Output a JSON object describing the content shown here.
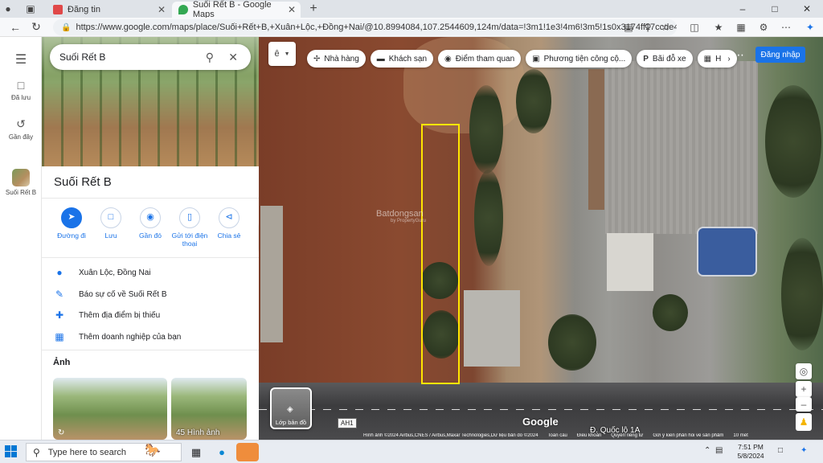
{
  "browser": {
    "tabs": [
      {
        "label": "Đăng tin",
        "active": false
      },
      {
        "label": "Suối Rết B - Google Maps",
        "active": true
      }
    ],
    "new_tab_label": "+",
    "url": "https://www.google.com/maps/place/Suối+Rết+B,+Xuân+Lộc,+Đồng+Nai/@10.8994084,107.2544609,124m/data=!3m1!1e3!4m6!3m5!1s0x3174ff17ccde4bf3:..."
  },
  "rail": {
    "saved_label": "Đã lưu",
    "recent_label": "Gần đây",
    "place_label": "Suối Rết B"
  },
  "panel": {
    "search_value": "Suối Rết B",
    "title": "Suối Rết B",
    "actions": [
      {
        "label": "Đường đi"
      },
      {
        "label": "Lưu"
      },
      {
        "label": "Gần đó"
      },
      {
        "label": "Gửi tới điện thoại"
      },
      {
        "label": "Chia sẻ"
      }
    ],
    "info": [
      {
        "label": "Xuân Lộc, Đồng Nai"
      },
      {
        "label": "Báo sự cố về Suối Rết B"
      },
      {
        "label": "Thêm địa điểm bị thiếu"
      },
      {
        "label": "Thêm doanh nghiệp của bạn"
      }
    ],
    "photos_title": "Ảnh",
    "photo_count_label": "45 Hình ảnh"
  },
  "map": {
    "lang_button": "ê",
    "chips": [
      {
        "icon": "restaurant-icon",
        "label": "Nhà hàng"
      },
      {
        "icon": "hotel-icon",
        "label": "Khách sạn"
      },
      {
        "icon": "camera-icon",
        "label": "Điểm tham quan"
      },
      {
        "icon": "transit-icon",
        "label": "Phương tiện công cộ..."
      },
      {
        "icon": "parking-icon",
        "label": "Bãi đỗ xe"
      },
      {
        "icon": "more-icon",
        "label": "H"
      }
    ],
    "sign_in_label": "Đăng nhập",
    "watermark": "Batdongsan",
    "watermark_sub": "by PropertyGuru",
    "layers_label": "Lớp bản đồ",
    "google_logo": "Google",
    "road_label": "Đ. Quốc lộ 1A",
    "highway_shield": "AH1",
    "attribution": [
      "Hình ảnh ©2024 Airbus,CNES / Airbus,Maxar Technologies,Dữ liệu bản đồ ©2024",
      "Toàn cầu",
      "Điều khoản",
      "Quyền riêng tư",
      "Gửi ý kiến phản hồi về sản phẩm",
      "10 mét"
    ],
    "parcel_color": "#ffe600"
  },
  "taskbar": {
    "search_placeholder": "Type here to search",
    "time": "7:51 PM",
    "date": "5/8/2024"
  },
  "colors": {
    "accent": "#1a73e8",
    "parcel": "#ffe600"
  }
}
